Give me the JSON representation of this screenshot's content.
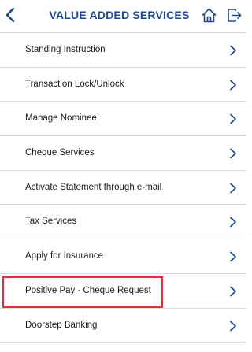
{
  "header": {
    "title": "VALUE ADDED SERVICES",
    "back_icon": "chevron-left-icon",
    "home_icon": "home-icon",
    "logout_icon": "logout-icon",
    "accent_color": "#1f4a8a"
  },
  "services": [
    {
      "label": "Standing Instruction"
    },
    {
      "label": "Transaction Lock/Unlock"
    },
    {
      "label": "Manage Nominee"
    },
    {
      "label": "Cheque Services"
    },
    {
      "label": "Activate Statement through e-mail"
    },
    {
      "label": "Tax Services"
    },
    {
      "label": "Apply for Insurance"
    },
    {
      "label": "Positive Pay - Cheque Request",
      "highlighted": true
    },
    {
      "label": "Doorstep Banking"
    }
  ],
  "highlight_color": "#e0303a"
}
